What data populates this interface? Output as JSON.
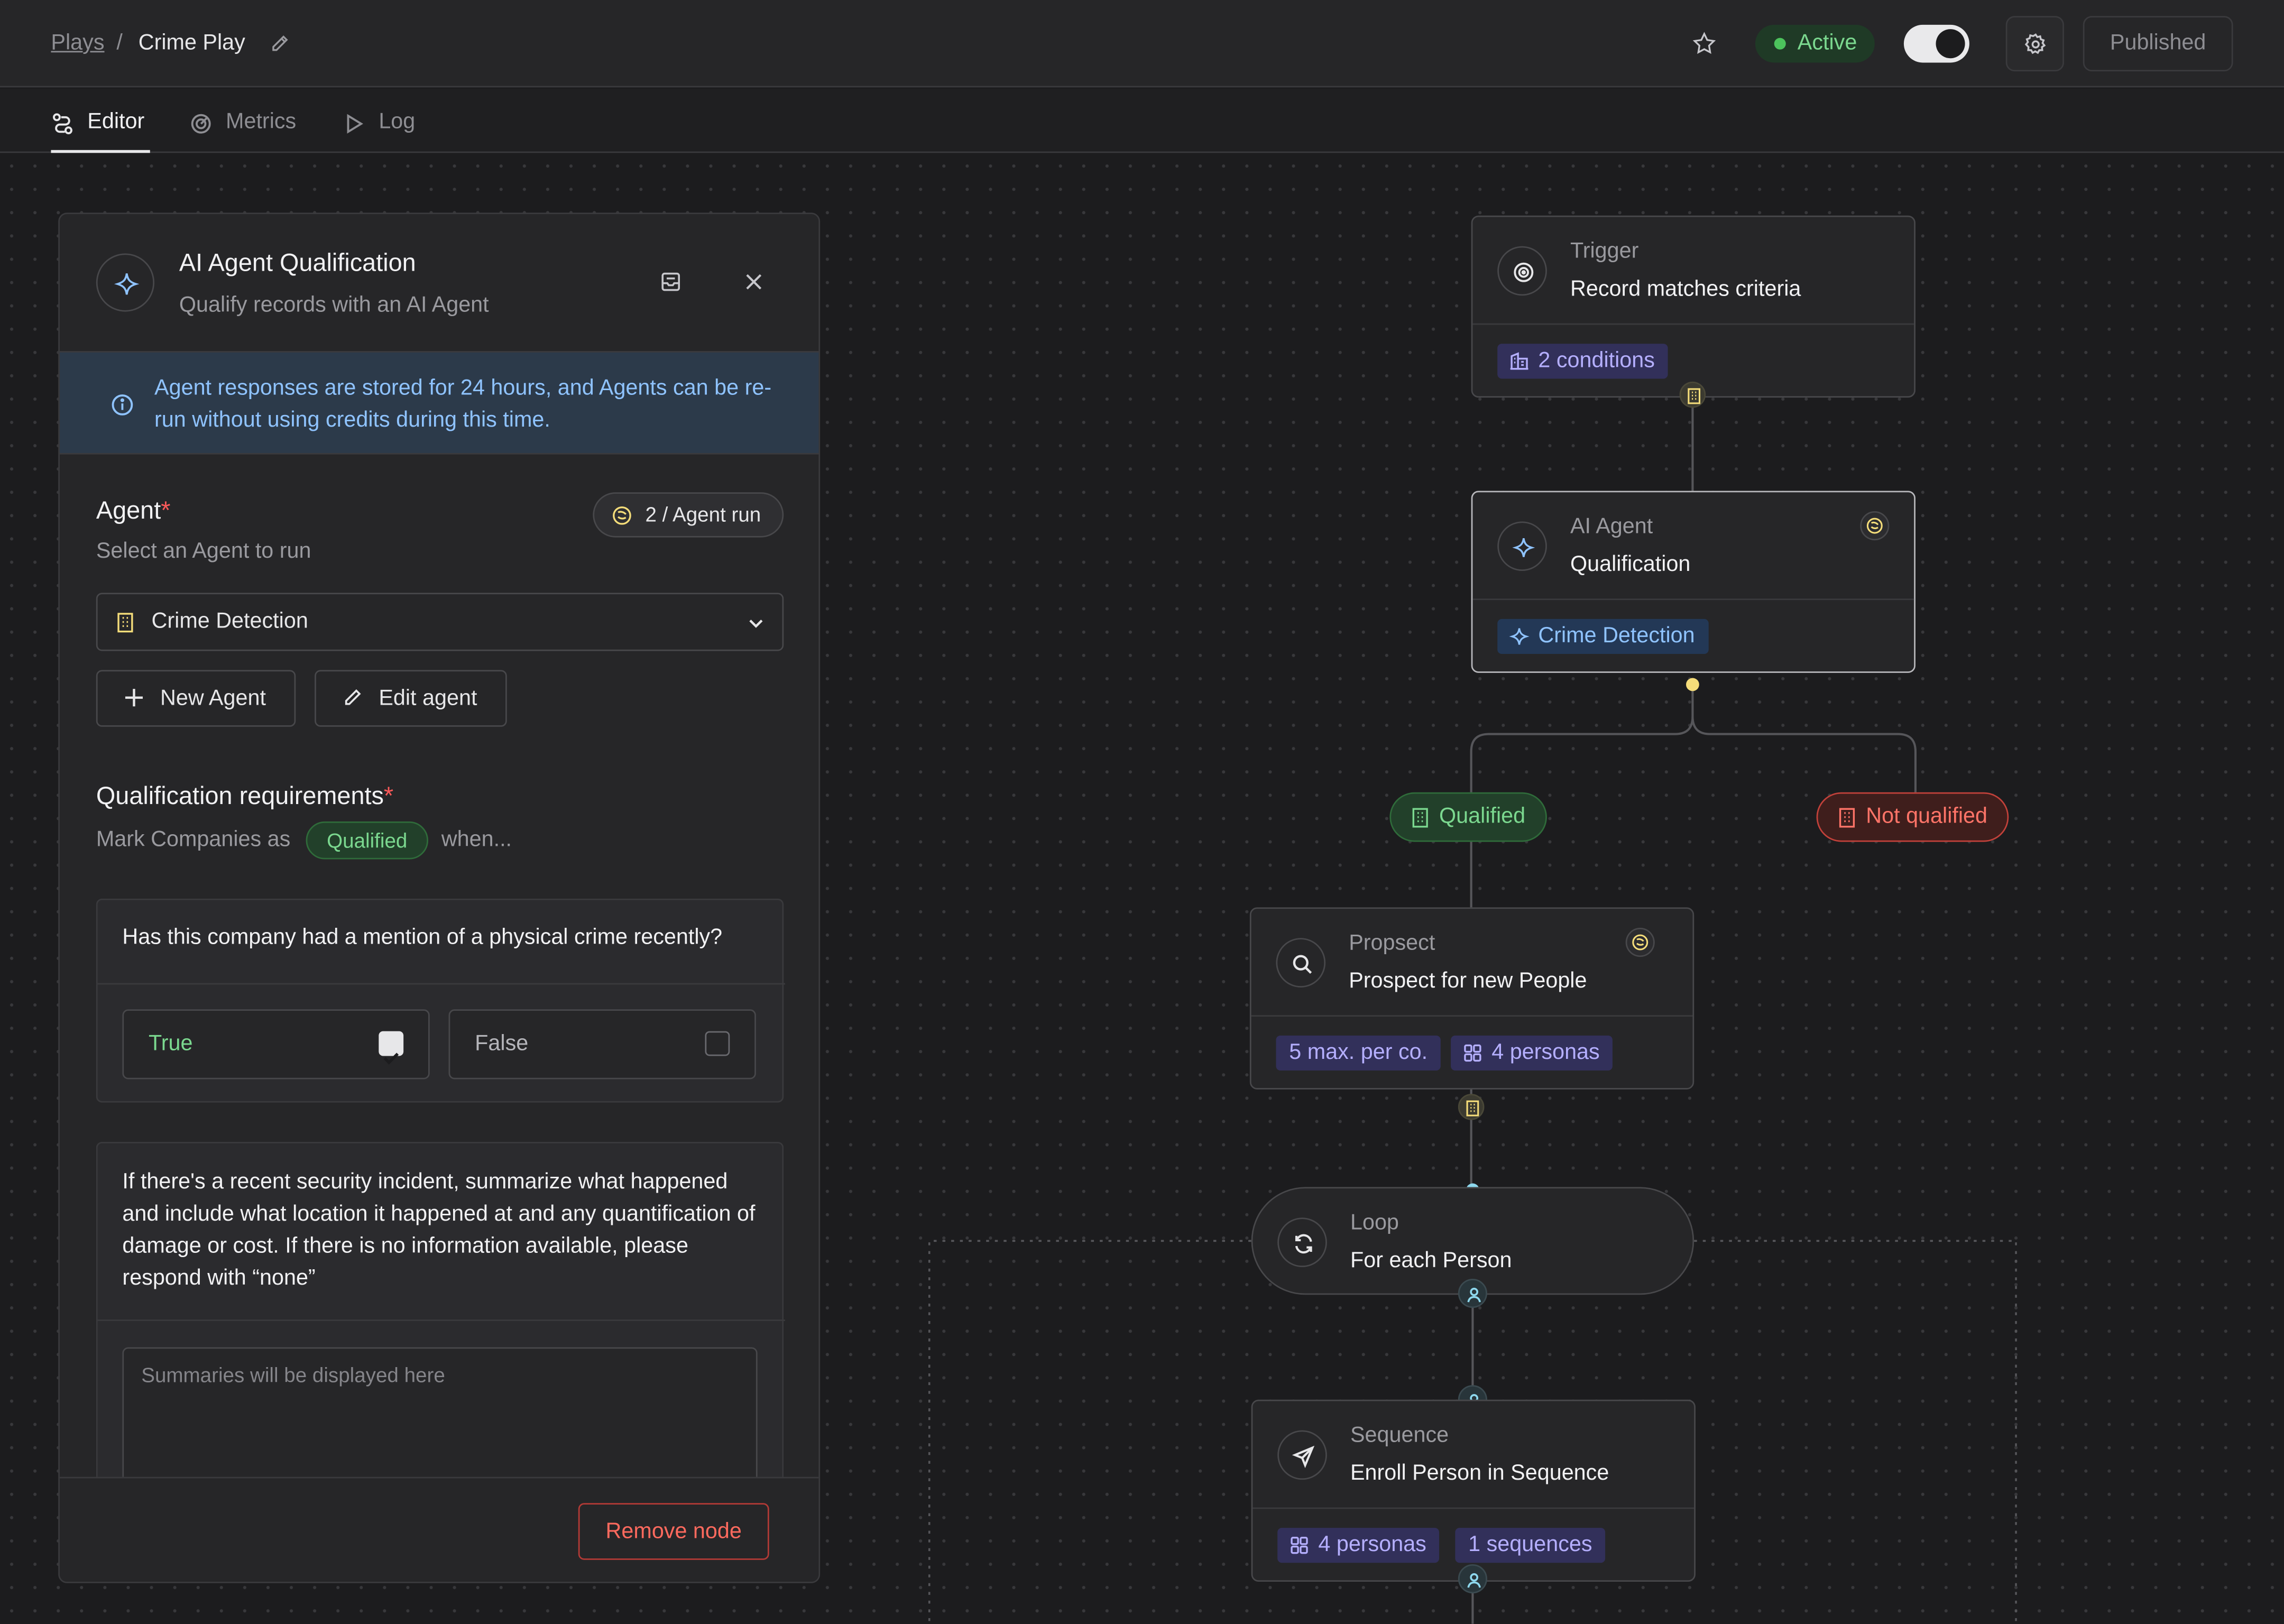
{
  "header": {
    "breadcrumb_root": "Plays",
    "breadcrumb_sep": "/",
    "breadcrumb_current": "Crime Play",
    "status": "Active",
    "publish_label": "Published"
  },
  "tabs": [
    {
      "label": "Editor",
      "icon": "workflow-icon",
      "active": true
    },
    {
      "label": "Metrics",
      "icon": "metrics-icon",
      "active": false
    },
    {
      "label": "Log",
      "icon": "play-icon",
      "active": false
    }
  ],
  "panel": {
    "title": "AI Agent Qualification",
    "subtitle": "Qualify records with an AI Agent",
    "info": "Agent responses are stored for 24 hours, and Agents can be re-run without using credits during this time.",
    "agent_label": "Agent",
    "required_mark": "*",
    "agent_sub": "Select an Agent to run",
    "cost": "2 / Agent run",
    "agent_selected": "Crime Detection",
    "new_agent": "New Agent",
    "edit_agent": "Edit agent",
    "qual_label": "Qualification requirements",
    "mark_prefix": "Mark Companies as",
    "mark_pill": "Qualified",
    "mark_suffix": "when...",
    "question": "Has this company had a mention of a physical crime recently?",
    "opt_true": "True",
    "opt_false": "False",
    "true_checked": true,
    "summary_prompt": "If there's a recent security incident, summarize what happened and include what location it happened at and any quantification of damage or cost. If there is no information available, please respond with “none”",
    "summary_placeholder": "Summaries will be displayed here",
    "remove": "Remove node"
  },
  "flow": {
    "trigger": {
      "type": "Trigger",
      "name": "Record matches criteria",
      "tag": "2 conditions"
    },
    "agent": {
      "type": "AI Agent",
      "name": "Qualification",
      "tag": "Crime Detection"
    },
    "branch_yes": "Qualified",
    "branch_no": "Not qualified",
    "prospect": {
      "type": "Propsect",
      "name": "Prospect for new People",
      "tag1": "5 max. per co.",
      "tag2": "4 personas"
    },
    "loop": {
      "type": "Loop",
      "name": "For each Person"
    },
    "sequence": {
      "type": "Sequence",
      "name": "Enroll Person in Sequence",
      "tag1": "4 personas",
      "tag2": "1 sequences"
    }
  },
  "colors": {
    "background": "#1c1c1e",
    "panel": "#262628",
    "active_green": "#7bd88f",
    "info_blue": "#8fc3ff",
    "danger_red": "#ff6a5e",
    "tag_purple": "#b5afff"
  }
}
